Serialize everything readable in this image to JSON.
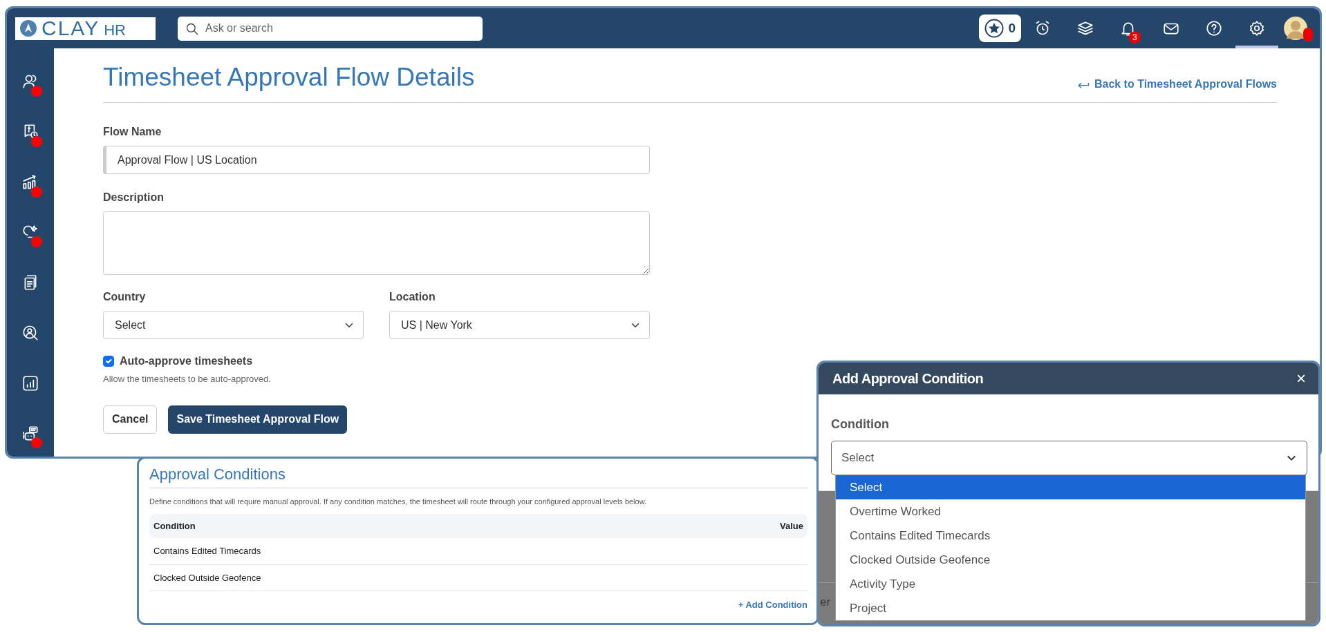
{
  "brand": {
    "name": "CLAY",
    "suffix": "HR"
  },
  "search": {
    "placeholder": "Ask or search"
  },
  "points": {
    "count": "0"
  },
  "top_icons": [
    {
      "kind": "alarm",
      "selected": false
    },
    {
      "kind": "layers",
      "selected": false
    },
    {
      "kind": "bell",
      "selected": false,
      "badge": "3"
    },
    {
      "kind": "mail",
      "selected": false
    },
    {
      "kind": "help",
      "selected": false
    },
    {
      "kind": "settings",
      "selected": true
    }
  ],
  "sidebar": {
    "items": [
      {
        "kind": "people",
        "alert": true
      },
      {
        "kind": "payroll",
        "alert": true
      },
      {
        "kind": "growth",
        "alert": true
      },
      {
        "kind": "ideas",
        "alert": true
      },
      {
        "kind": "documents",
        "alert": false
      },
      {
        "kind": "recruiting",
        "alert": false
      },
      {
        "kind": "reports",
        "alert": false
      },
      {
        "kind": "assistant",
        "alert": true
      }
    ]
  },
  "page": {
    "title": "Timesheet Approval Flow Details",
    "back_link": "Back to Timesheet Approval Flows"
  },
  "form": {
    "flow_name": {
      "label": "Flow Name",
      "value": "Approval Flow | US Location"
    },
    "description": {
      "label": "Description"
    },
    "country": {
      "label": "Country",
      "value": "Select"
    },
    "location": {
      "label": "Location",
      "value": "US | New York"
    },
    "auto_approve": {
      "label": "Auto-approve timesheets",
      "checked": true,
      "help": "Allow the timesheets to be auto-approved."
    },
    "buttons": [
      {
        "kind": "secondary",
        "label": "Cancel"
      },
      {
        "kind": "primary",
        "label": "Save Timesheet Approval Flow"
      }
    ]
  },
  "conditions_panel": {
    "title": "Approval Conditions",
    "description": "Define conditions that will require manual approval. If any condition matches, the timesheet will route through your configured approval levels below.",
    "columns": [
      "Condition",
      "Value"
    ],
    "rows": [
      {
        "condition": "Contains Edited Timecards"
      },
      {
        "condition": "Clocked Outside Geofence"
      }
    ],
    "add_link": "+ Add Condition"
  },
  "modal": {
    "title": "Add Approval Condition",
    "close": "×",
    "field_label": "Condition",
    "value": "Select",
    "options": [
      {
        "label": "Select",
        "selected": true
      },
      {
        "label": "Overtime Worked",
        "selected": false
      },
      {
        "label": "Contains Edited Timecards",
        "selected": false
      },
      {
        "label": "Clocked Outside Geofence",
        "selected": false
      },
      {
        "label": "Activity Type",
        "selected": false
      },
      {
        "label": "Project",
        "selected": false
      }
    ],
    "backdrop_text": "er"
  }
}
